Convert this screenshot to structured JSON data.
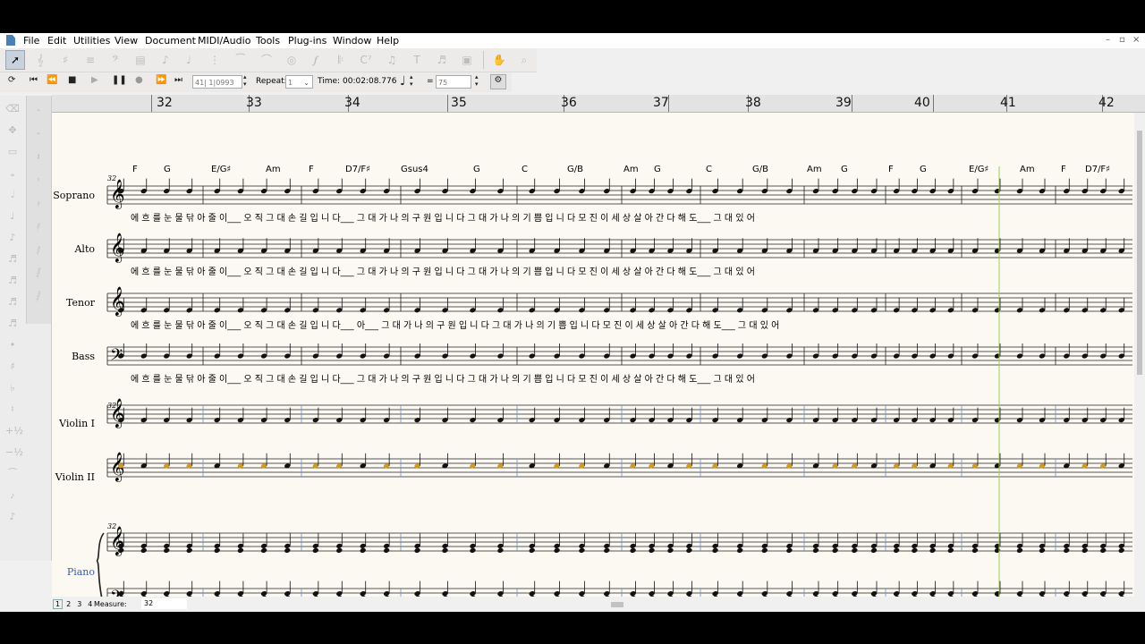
{
  "menu": [
    "File",
    "Edit",
    "Utilities",
    "View",
    "Document",
    "MIDI/Audio",
    "Tools",
    "Plug-ins",
    "Window",
    "Help"
  ],
  "window_controls": [
    "–",
    "▫",
    "×"
  ],
  "playback": {
    "position": "41| 1|0993",
    "repeat_label": "Repeat:",
    "repeat_value": "1",
    "time_label": "Time:",
    "time_value": "00:02:08.776",
    "tempo_equals": "=",
    "tempo_value": "75"
  },
  "ruler_measures": [
    "32",
    "33",
    "34",
    "35",
    "36",
    "37",
    "38",
    "39",
    "40",
    "41",
    "42"
  ],
  "staves": [
    {
      "name": "Soprano",
      "lyrics": "에 흐 를 눈 물   닦 아 줄 이___   오 직 그 대 손 길   입 니 다___   그 대   가   나 의 구 원 입 니   다   그 대   가   나 의 기 쁨 입 니   다   모 진   이  세 상 살 아   간 다 해 도___   그 대 있 어"
    },
    {
      "name": "Alto",
      "lyrics": "에 흐 를 눈 물   닦 아 줄 이___   오 직 그 대 손 길   입 니 다___   그 대   가   나 의 구 원 입 니   다   그 대   가   나 의 기 쁨 입 니   다   모 진   이  세 상 살 아   간 다 해 도___   그 대 있 어"
    },
    {
      "name": "Tenor",
      "lyrics": "에 흐 를 눈 물   닦 아 줄 이___   오 직 그 대 손 길   입 니 다___ 아___   그 대   가   나 의 구 원 입 니   다   그 대   가   나 의 기 쁨 입 니   다   모 진   이  세 상 살 아   간 다 해 도___   그 대 있 어"
    },
    {
      "name": "Bass",
      "lyrics": "에 흐 를 눈 물   닦 아 줄 이___   오 직 그 대 손 길   입 니 다___   그 대   가   나 의 구 원 입 니   다   그 대   가   나 의 기 쁨 입 니   다   모 진   이  세 상 살 아   간 다 해 도___   그 대 있 어"
    },
    {
      "name": "Violin I",
      "lyrics": ""
    },
    {
      "name": "Violin II",
      "lyrics": ""
    },
    {
      "name": "Piano",
      "lyrics": ""
    }
  ],
  "chords": [
    {
      "m": 0,
      "t": "F"
    },
    {
      "m": 0,
      "t": "G"
    },
    {
      "m": 1,
      "t": "E/G♯"
    },
    {
      "m": 1,
      "t": "Am"
    },
    {
      "m": 2,
      "t": "F"
    },
    {
      "m": 2,
      "t": "D7/F♯"
    },
    {
      "m": 3,
      "t": "Gsus4"
    },
    {
      "m": 3,
      "t": "G"
    },
    {
      "m": 4,
      "t": "C"
    },
    {
      "m": 4,
      "t": "G/B"
    },
    {
      "m": 5,
      "t": "Am"
    },
    {
      "m": 5,
      "t": "G"
    },
    {
      "m": 6,
      "t": "C"
    },
    {
      "m": 6,
      "t": "G/B"
    },
    {
      "m": 7,
      "t": "Am"
    },
    {
      "m": 7,
      "t": "G"
    },
    {
      "m": 8,
      "t": "F"
    },
    {
      "m": 8,
      "t": "G"
    },
    {
      "m": 9,
      "t": "E/G♯"
    },
    {
      "m": 9,
      "t": "Am"
    },
    {
      "m": 10,
      "t": "F"
    },
    {
      "m": 10,
      "t": "D7/F♯"
    }
  ],
  "system_number": "32",
  "status": {
    "pages": [
      "1",
      "2",
      "3",
      "4"
    ],
    "measure_label": "Measure:",
    "measure_value": "32"
  }
}
